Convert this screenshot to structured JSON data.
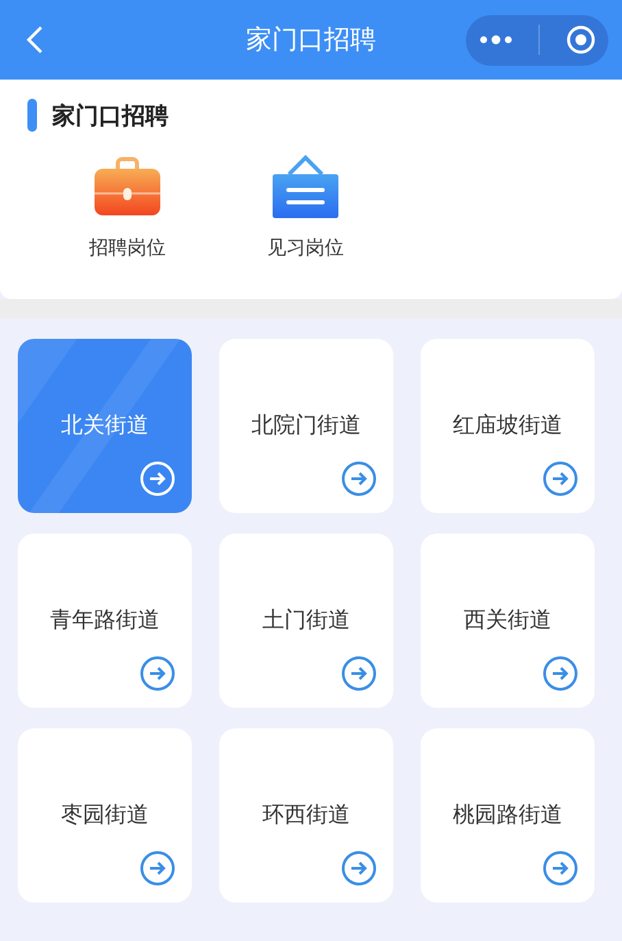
{
  "window": {
    "title": "家门口招聘"
  },
  "section": {
    "title": "家门口招聘",
    "items": [
      {
        "label": "招聘岗位",
        "kind": "briefcase"
      },
      {
        "label": "见习岗位",
        "kind": "sign"
      }
    ]
  },
  "streets": [
    {
      "name": "北关街道",
      "selected": true
    },
    {
      "name": "北院门街道",
      "selected": false
    },
    {
      "name": "红庙坡街道",
      "selected": false
    },
    {
      "name": "青年路街道",
      "selected": false
    },
    {
      "name": "土门街道",
      "selected": false
    },
    {
      "name": "西关街道",
      "selected": false
    },
    {
      "name": "枣园街道",
      "selected": false
    },
    {
      "name": "环西街道",
      "selected": false
    },
    {
      "name": "桃园路街道",
      "selected": false
    }
  ]
}
